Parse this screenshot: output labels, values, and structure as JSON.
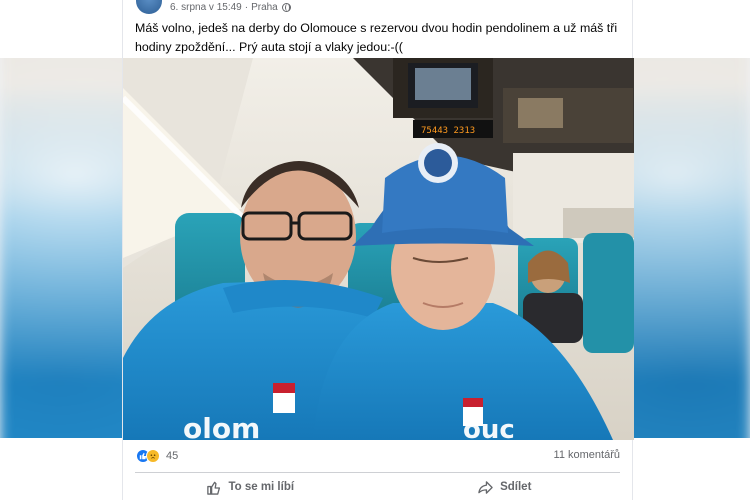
{
  "post": {
    "date": "6. srpna v 15:49",
    "separator": "·",
    "location": "Praha",
    "text": "Máš volno, jedeš na derby do Olomouce s rezervou dvou hodin pendolinem a už máš tři hodiny zpoždění... Prý auta stojí a vlaky jedou:-(("
  },
  "photo": {
    "station_board": "75443 2313"
  },
  "stats": {
    "reaction_count": "45",
    "comments": "11 komentářů"
  },
  "actions": {
    "like": "To se mi líbí",
    "share": "Sdílet"
  },
  "colors": {
    "like_blue": "#1877f2",
    "sad_yellow": "#f7b928",
    "hoodie_blue": "#1f8ed1",
    "cap_blue": "#2e6fb5"
  },
  "icons": [
    "globe-icon",
    "like-reaction-icon",
    "sad-reaction-icon",
    "thumbs-up-icon",
    "share-arrow-icon"
  ]
}
